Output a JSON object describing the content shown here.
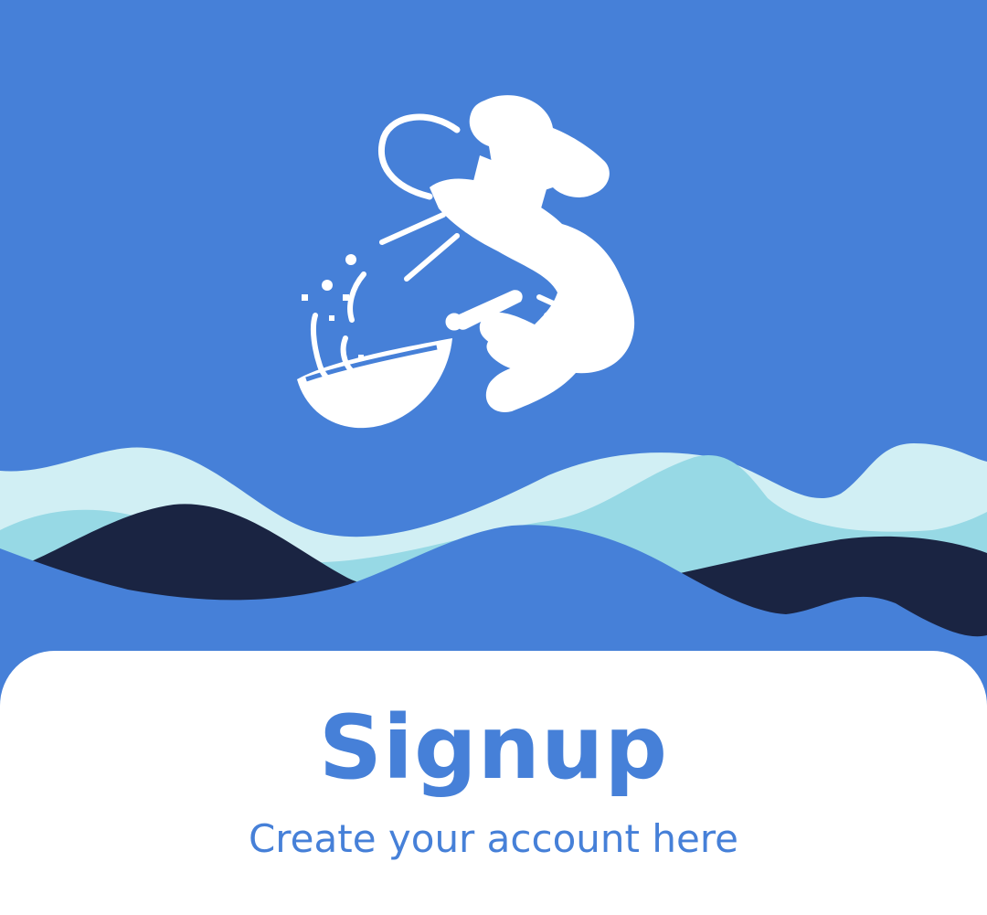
{
  "colors": {
    "background": "#4680d8",
    "card": "#ffffff",
    "accent_text": "#4680d8",
    "wave_light": "#d1eff4",
    "wave_mid": "#97d9e5",
    "wave_dark": "#1a2442",
    "illustration": "#ffffff"
  },
  "illustration": {
    "icon": "chef-shrimp-wok-icon"
  },
  "signup": {
    "title": "Signup",
    "subtitle": "Create your account here"
  }
}
